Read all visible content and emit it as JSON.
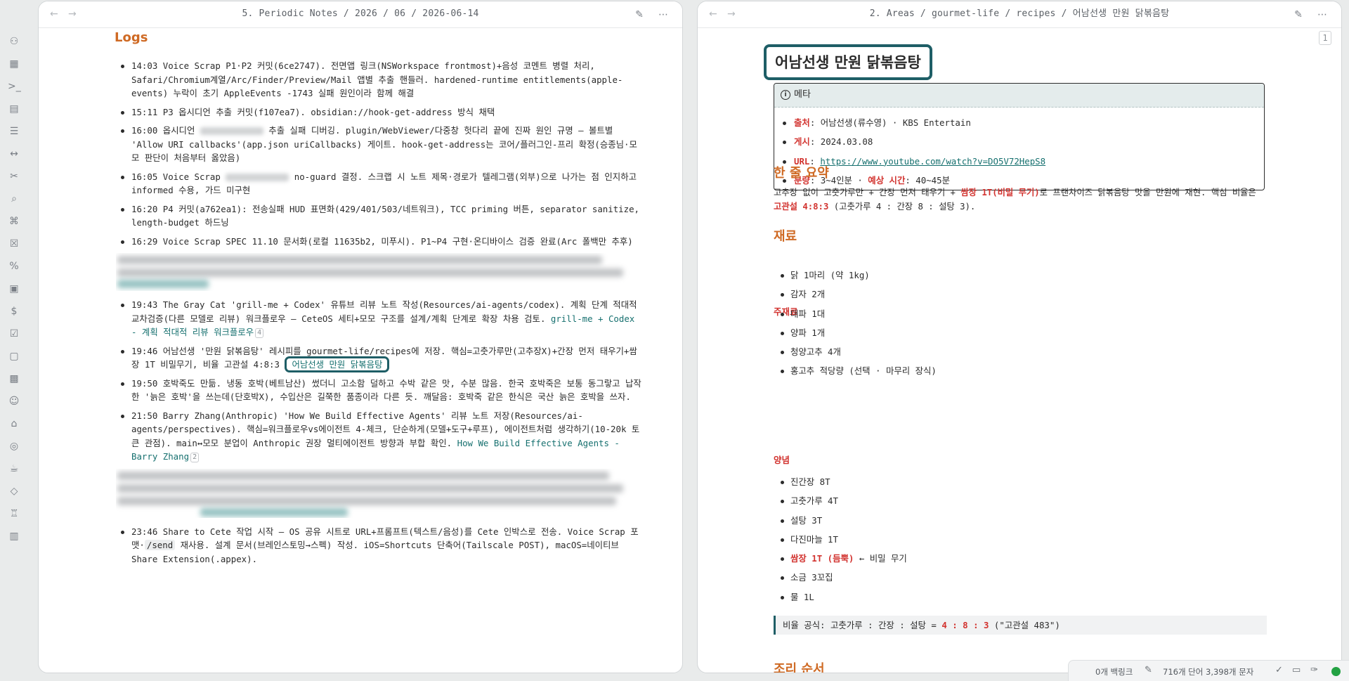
{
  "ribbon": {
    "icons": [
      "graph-icon",
      "dashboard-icon",
      "terminal-icon",
      "layout-icon",
      "list-icon",
      "arrows-icon",
      "tools-icon",
      "search-icon",
      "tag-icon",
      "x-box-icon",
      "percent-icon",
      "file-search-icon",
      "dollar-icon",
      "checkbox-icon",
      "file-check-icon",
      "image-icon",
      "face-icon",
      "graduation-icon",
      "compass-icon",
      "cup-icon",
      "bookmark-tag-icon",
      "robot-icon",
      "calendar-icon"
    ]
  },
  "left_pane": {
    "breadcrumb": "5. Periodic Notes / 2026 / 06 / 2026-06-14",
    "heading": "Logs",
    "entries": [
      "14:03 Voice Scrap P1·P2 커밋(6ce2747). 전면앱 링크(NSWorkspace frontmost)+음성 코멘트 병렬 처리, Safari/Chromium계열/Arc/Finder/Preview/Mail 앱별 추출 핸들러. hardened-runtime entitlements(apple-events) 누락이 초기 AppleEvents -1743 실패 원인이라 함께 해결",
      "15:11 P3 옵시디언 추출 커밋(f107ea7). obsidian://hook-get-address 방식 채택",
      "16:00 옵시디언",
      "추출 실패 디버깅. plugin/WebViewer/다중창 헛다리 끝에 진짜 원인 규명 — 볼트별 'Allow URI callbacks'(app.json uriCallbacks) 게이트. hook-get-address는 코어/플러그인-프리 확정(승종님·모모 판단이 처음부터 옳았음)",
      "16:05 Voice Scrap",
      "no-guard 결정. 스크랩 시 노트 제목·경로가 텔레그램(외부)으로 나가는 점 인지하고 informed 수용, 가드 미구현",
      "16:20 P4 커밋(a762ea1): 전송실패 HUD 표면화(429/401/503/네트워크), TCC priming 버튼, separator sanitize, length-budget 하드닝",
      "16:29 Voice Scrap SPEC 11.10 문서화(로컬 11635b2, 미푸시). P1~P4 구현·온디바이스 검증 완료(Arc 폴백만 추후)",
      "19:43 The Gray Cat 'grill-me + Codex' 유튜브 리뷰 노트 작성(Resources/ai-agents/codex). 계획 단계 적대적 교차검증(다른 모델로 리뷰) 워크플로우 — CeteOS 세티+모모 구조를 설계/계획 단계로 확장 차용 검토.",
      "grill-me + Codex - 계획 적대적 리뷰 워크플로우",
      "4",
      "19:46 어남선생 '만원 닭볶음탕' 레시피를 gourmet-life/recipes에 저장. 핵심=고춧가루만(고추장X)+간장 먼저 태우기+쌈장 1T 비밀무기, 비율 고관설 4:8:3",
      "어남선생 만원 닭볶음탕",
      "19:50 호박죽도 만듦. 냉동 호박(베트남산) 썼더니 고소함 덜하고 수박 같은 맛, 수분 많음. 한국 호박죽은 보통 동그랗고 납작한 '늙은 호박'을 쓰는데(단호박X), 수입산은 길쭉한 품종이라 다른 듯. 깨달음: 호박죽 같은 한식은 국산 늙은 호박을 쓰자.",
      "21:50 Barry Zhang(Anthropic) 'How We Build Effective Agents' 리뷰 노트 저장(Resources/ai-agents/perspectives). 핵심=워크플로우vs에이전트 4-체크, 단순하게(모델+도구+루프), 에이전트처럼 생각하기(10-20k 토큰 관점). main↔모모 분업이 Anthropic 권장 멀티에이전트 방향과 부합 확인.",
      "How We Build Effective Agents - Barry Zhang",
      "2",
      "23:46 Share to Cete 작업 시작 — OS 공유 시트로 URL+프롬프트(텍스트/음성)를 Cete 인박스로 전송. Voice Scrap 포맷·",
      "/send",
      "재사용. 설계 문서(브레인스토밍→스펙) 작성. iOS=Shortcuts 단축어(Tailscale POST), macOS=네이티브 Share Extension(.appex)."
    ]
  },
  "right_pane": {
    "breadcrumb": "2. Areas / gourmet-life / recipes / 어남선생 만원 닭볶음탕",
    "page_number": "1",
    "title": "어남선생 만원 닭볶음탕",
    "callout_title": "메타",
    "meta": [
      {
        "key": "출처",
        "value": ": 어남선생(류수영) · KBS Entertain"
      },
      {
        "key": "게시",
        "value": ": 2024.03.08"
      },
      {
        "key": "URL",
        "value": "https://www.youtube.com/watch?v=DO5V72HepS8"
      },
      {
        "key": "분량",
        "value": ": 3~4인분 · ",
        "key2": "예상 시간",
        "value2": ": 40~45분"
      }
    ],
    "summary_heading": "한 줄 요약",
    "summary_a": "고추장 없이 고춧가루만 + 간장 먼저 태우기 + ",
    "summary_b": "쌈장 1T(비밀 무기)",
    "summary_c": "로 프랜차이즈 닭볶음탕 맛을 만원에 재현. 핵심 비율은 ",
    "summary_d": "고관설 4:8:3",
    "summary_e": " (고춧가루 4 : 간장 8 : 설탕 3).",
    "ingredients_heading": "재료",
    "main_sub": "주재료",
    "main_items": [
      "닭 1마리 (약 1kg)",
      "감자 2개",
      "대파 1대",
      "양파 1개",
      "청양고추 4개",
      "홍고추 적당량 (선택 · 마무리 장식)"
    ],
    "sauce_sub": "양념",
    "sauce_items": [
      "진간장 8T",
      "고춧가루 4T",
      "설탕 3T",
      "다진마늘 1T"
    ],
    "sauce_special_a": "쌈장 1T (듬뿍)",
    "sauce_special_b": " ← 비밀 무기",
    "sauce_items2": [
      "소금 3꼬집",
      "물 1L"
    ],
    "formula_a": "비율 공식: 고춧가루 : 간장 : 설탕 = ",
    "formula_b": "4 : 8 : 3",
    "formula_c": " (\"고관설 483\")",
    "steps_heading": "조리 순서"
  },
  "status_bar": {
    "backlinks": "0개 백링크",
    "counts": "716개 단어 3,398개 문자"
  },
  "colors": {
    "accent_orange": "#cf6a24",
    "accent_red": "#d2332f",
    "link_teal": "#16706f",
    "highlight_border": "#1e5e66"
  }
}
